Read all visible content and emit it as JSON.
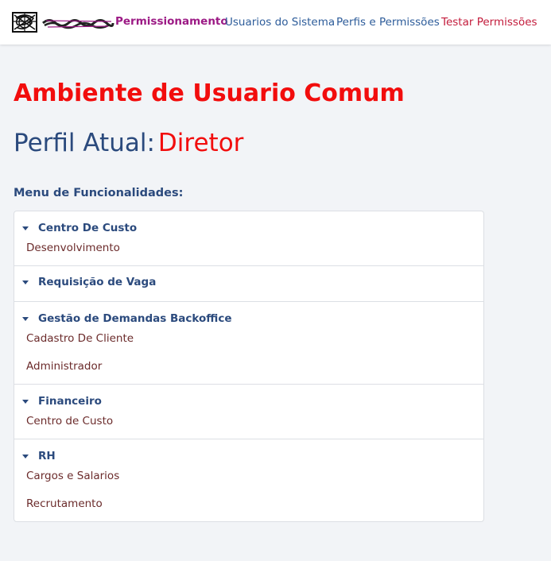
{
  "navbar": {
    "logo_icon": "scribbled-logo-icon",
    "brand": "Permissionamento",
    "links": [
      {
        "label": "Usuarios do Sistema",
        "color": "#2d5c9a"
      },
      {
        "label": "Perfis e Permissões",
        "color": "#2d5c9a"
      },
      {
        "label": "Testar Permissões",
        "color": "#c31b3b"
      }
    ]
  },
  "main": {
    "heading": "Ambiente de Usuario Comum",
    "profile_label": "Perfil Atual:",
    "profile_value": "Diretor",
    "menu_title": "Menu de Funcionalidades:",
    "groups": [
      {
        "label": "Centro De Custo",
        "items": [
          "Desenvolvimento"
        ]
      },
      {
        "label": "Requisição de Vaga",
        "items": []
      },
      {
        "label": "Gestão de Demandas Backoffice",
        "items": [
          "Cadastro De Cliente",
          "Administrador"
        ]
      },
      {
        "label": "Financeiro",
        "items": [
          "Centro de Custo"
        ]
      },
      {
        "label": "RH",
        "items": [
          "Cargos e Salarios",
          "Recrutamento"
        ]
      }
    ]
  },
  "colors": {
    "accent_red": "#f20d0d",
    "navy": "#2b4a7d",
    "brand_purple": "#9c1a85",
    "item_text": "#6b2b2b"
  }
}
